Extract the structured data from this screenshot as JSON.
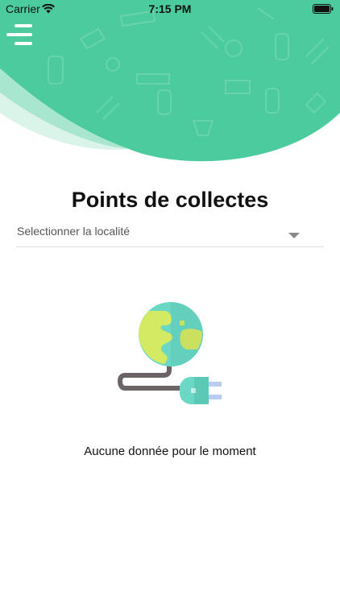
{
  "status_bar": {
    "carrier": "Carrier",
    "time": "7:15 PM",
    "wifi_icon": "wifi-icon",
    "battery_icon": "battery-icon"
  },
  "header": {
    "menu_icon": "hamburger-menu-icon",
    "color": "#4ccb9f"
  },
  "main": {
    "title": "Points de collectes",
    "locality_select": {
      "placeholder": "Selectionner la localité",
      "icon": "chevron-down-icon"
    },
    "empty_state": {
      "icon": "globe-plug-icon",
      "message": "Aucune donnée pour le moment"
    }
  }
}
